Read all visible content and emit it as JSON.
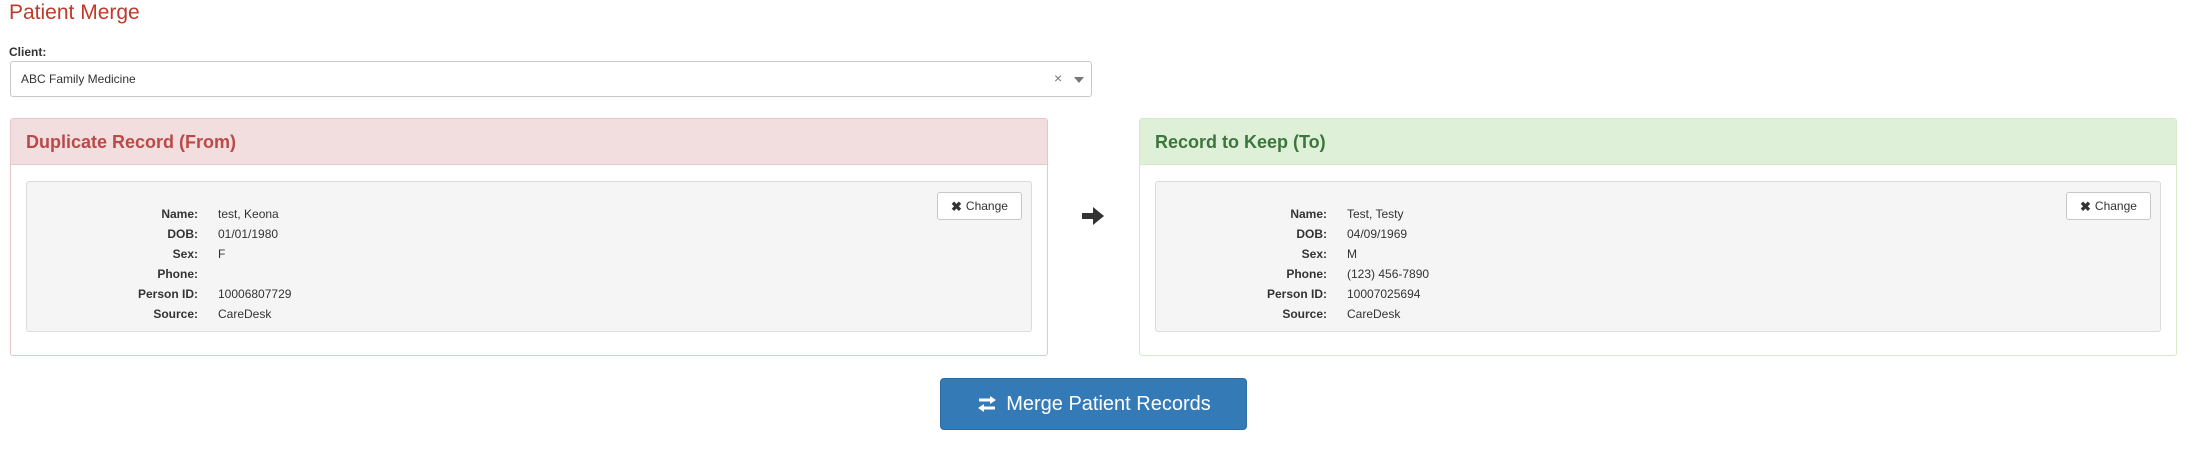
{
  "page": {
    "title": "Patient Merge"
  },
  "client": {
    "label": "Client:",
    "selected": "ABC Family Medicine",
    "clear_glyph": "×"
  },
  "labels": {
    "name": "Name:",
    "dob": "DOB:",
    "sex": "Sex:",
    "phone": "Phone:",
    "person_id": "Person ID:",
    "source": "Source:"
  },
  "from_record": {
    "heading": "Duplicate Record (From)",
    "change_label": "Change",
    "name": "test, Keona",
    "dob": "01/01/1980",
    "sex": "F",
    "phone": "",
    "person_id": "10006807729",
    "source": "CareDesk"
  },
  "to_record": {
    "heading": "Record to Keep (To)",
    "change_label": "Change",
    "name": "Test, Testy",
    "dob": "04/09/1969",
    "sex": "M",
    "phone": "(123) 456-7890",
    "person_id": "10007025694",
    "source": "CareDesk"
  },
  "merge_button": {
    "label": "Merge Patient Records"
  },
  "icons": {
    "change": "times-icon",
    "direction": "arrow-right-icon",
    "merge": "exchange-icon"
  },
  "colors": {
    "title": "#c0392b",
    "from_heading": "#b94a48",
    "from_bg": "#f2dede",
    "to_heading": "#3c763d",
    "to_bg": "#dff0d8",
    "primary": "#337ab7"
  }
}
